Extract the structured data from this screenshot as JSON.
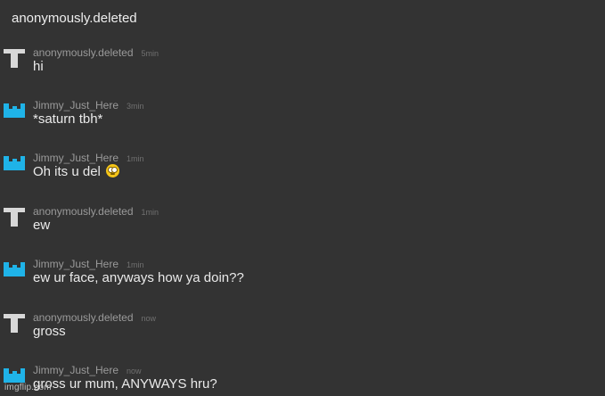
{
  "header": {
    "title": "anonymously.deleted"
  },
  "colors": {
    "background": "#333333",
    "jimmy_avatar": "#1fb3e8",
    "anon_avatar": "#d8d8d8"
  },
  "messages": [
    {
      "user": "anonymously.deleted",
      "time": "5min",
      "text": "hi",
      "avatar": "gray-t-avatar"
    },
    {
      "user": "Jimmy_Just_Here",
      "time": "3min",
      "text": "*saturn tbh*",
      "avatar": "blue-u-avatar"
    },
    {
      "user": "Jimmy_Just_Here",
      "time": "1min",
      "text": "Oh its u del",
      "avatar": "blue-u-avatar",
      "emoji": "face-with-rolling-eyes"
    },
    {
      "user": "anonymously.deleted",
      "time": "1min",
      "text": "ew",
      "avatar": "gray-t-avatar"
    },
    {
      "user": "Jimmy_Just_Here",
      "time": "1min",
      "text": "ew ur face, anyways how ya doin??",
      "avatar": "blue-u-avatar"
    },
    {
      "user": "anonymously.deleted",
      "time": "now",
      "text": "gross",
      "avatar": "gray-t-avatar"
    },
    {
      "user": "Jimmy_Just_Here",
      "time": "now",
      "text": "gross ur mum, ANYWAYS hru?",
      "avatar": "blue-u-avatar"
    }
  ],
  "watermark": "imgflip.com"
}
